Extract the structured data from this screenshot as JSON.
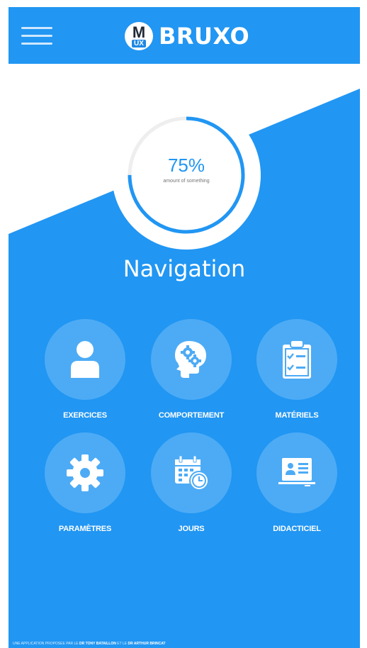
{
  "header": {
    "logo_letter": "M",
    "logo_sub": "UX",
    "brand": "BRUXO"
  },
  "progress": {
    "value_text": "75%",
    "caption": "amount of something",
    "fraction": 0.75,
    "color": "#2196f3",
    "track_color": "#eeeeee"
  },
  "nav": {
    "title": "Navigation",
    "items": [
      {
        "label": "EXERCICES",
        "icon": "person-icon"
      },
      {
        "label": "COMPORTEMENT",
        "icon": "brain-gears-icon"
      },
      {
        "label": "MATÉRIELS",
        "icon": "clipboard-checklist-icon"
      },
      {
        "label": "PARAMÈTRES",
        "icon": "gear-icon"
      },
      {
        "label": "JOURS",
        "icon": "calendar-clock-icon"
      },
      {
        "label": "DIDACTICIEL",
        "icon": "presentation-board-icon"
      }
    ]
  },
  "footer": {
    "prefix": "UNE APPLICATION PROPOSEE PAR LE",
    "author1": "DR TONY BATAILLON",
    "middle": "ET LE",
    "author2": "DR ARTHUR BRINCAT"
  },
  "colors": {
    "primary": "#2196f3",
    "circle": "#4dabf5",
    "text_on_primary": "#ffffff"
  }
}
